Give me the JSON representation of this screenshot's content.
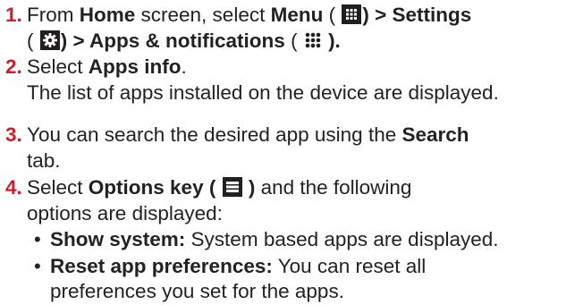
{
  "steps": [
    {
      "number": "1.",
      "line1": {
        "t1": "From ",
        "b1": "Home",
        "t2": " screen, select ",
        "b2": "Menu",
        "t3": " ( ",
        "b3": ") > Settings"
      },
      "line2": {
        "t1": "( ",
        "b1": ") > Apps & notifications",
        "t2": " ( ",
        "t3": " )."
      }
    },
    {
      "number": "2.",
      "t1": "Select ",
      "b1": "Apps info",
      "t2": ".",
      "line2": "The list of apps installed on the device are displayed."
    },
    {
      "number": "3.",
      "t1": "You can search the desired app using the ",
      "b1": "Search",
      "line2": "tab."
    },
    {
      "number": "4.",
      "t1": "Select ",
      "b1": "Options key ( ",
      "b2": " )",
      "t2": " and the following",
      "line2": "options are displayed:"
    }
  ],
  "bullets": [
    {
      "label": "Show system:",
      "text": " System based apps are displayed."
    },
    {
      "label": "Reset app preferences:",
      "text": " You can reset all",
      "line2": "preferences you set for the apps."
    }
  ],
  "icons": {
    "menu": "grid-menu-icon",
    "settings": "gear-icon",
    "apps": "dots-grid-icon",
    "options": "options-list-icon"
  },
  "colors": {
    "step_number": "#cc1f2a",
    "text": "#222222",
    "icon_bg": "#231f20"
  }
}
